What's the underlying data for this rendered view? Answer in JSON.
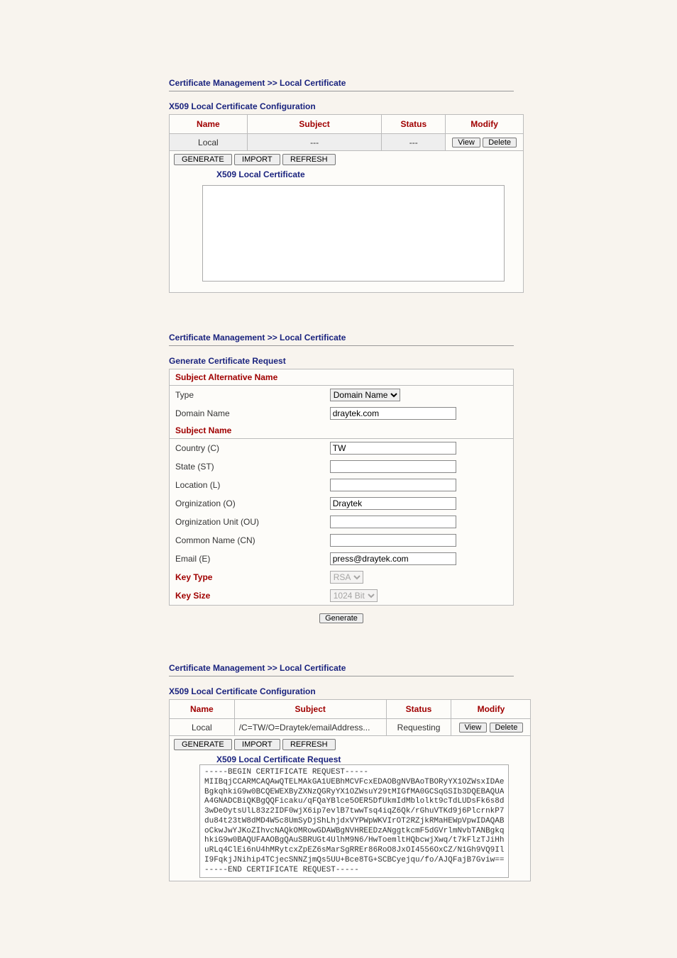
{
  "breadcrumb": "Certificate Management >> Local Certificate",
  "panel1": {
    "config_title": "X509 Local Certificate Configuration",
    "cols": {
      "name": "Name",
      "subject": "Subject",
      "status": "Status",
      "modify": "Modify"
    },
    "row": {
      "name": "Local",
      "subject": "---",
      "status": "---"
    },
    "btn_view": "View",
    "btn_delete": "Delete",
    "btn_generate": "GENERATE",
    "btn_import": "IMPORT",
    "btn_refresh": "REFRESH",
    "cert_title": "X509 Local Certificate",
    "cert_text": ""
  },
  "panel2": {
    "form_title": "Generate Certificate Request",
    "san_title": "Subject Alternative Name",
    "type_label": "Type",
    "type_value": "Domain Name",
    "dn_label": "Domain Name",
    "dn_value": "draytek.com",
    "sn_title": "Subject Name",
    "country_label": "Country (C)",
    "country_value": "TW",
    "state_label": "State (ST)",
    "state_value": "",
    "loc_label": "Location (L)",
    "loc_value": "",
    "org_label": "Orginization (O)",
    "org_value": "Draytek",
    "ou_label": "Orginization Unit (OU)",
    "ou_value": "",
    "cn_label": "Common Name (CN)",
    "cn_value": "",
    "email_label": "Email (E)",
    "email_value": "press@draytek.com",
    "keytype_label": "Key Type",
    "keytype_value": "RSA",
    "keysize_label": "Key Size",
    "keysize_value": "1024 Bit",
    "btn_generate": "Generate"
  },
  "panel3": {
    "config_title": "X509 Local Certificate Configuration",
    "cols": {
      "name": "Name",
      "subject": "Subject",
      "status": "Status",
      "modify": "Modify"
    },
    "row": {
      "name": "Local",
      "subject": "/C=TW/O=Draytek/emailAddress...",
      "status": "Requesting"
    },
    "btn_view": "View",
    "btn_delete": "Delete",
    "btn_generate": "GENERATE",
    "btn_import": "IMPORT",
    "btn_refresh": "REFRESH",
    "req_title": "X509 Local Certificate Request",
    "req_text": "-----BEGIN CERTIFICATE REQUEST-----\nMIIBqjCCARMCAQAwQTELMAkGA1UEBhMCVFcxEDAOBgNVBAoTBORyYX1OZWsxIDAe\nBgkqhkiG9w0BCQEWEXByZXNzQGRyYX1OZWsuY29tMIGfMA0GCSqGSIb3DQEBAQUA\nA4GNADCBiQKBgQQFicaku/qFQaYBlce5OER5DfUkmIdMblolkt9cTdLUDsFk6s8d\n3wDeOytsUlL83z2IDF0wjX6ip7evlB7twwTsq4iqZ6Qk/rGhuVTKd9j6PlcrnkP7\ndu84t23tW8dMD4W5c8UmSyDjShLhjdxVYPWpWKVIrOT2RZjkRMaHEWpVpwIDAQAB\noCkwJwYJKoZIhvcNAQkOMRowGDAWBgNVHREEDzANggtkcmF5dGVrlmNvbTANBgkq\nhkiG9w0BAQUFAAOBgQAuSBRUGt4UlhM9N6/HwToemltHQbcwjXwq/t7kFlzTJiHh\nuRLq4ClEi6nU4hMRytcxZpEZ6sMarSgRREr86RoO8JxOI4556OxCZ/N1Gh9VQ9Il\nI9FqkjJNihip4TCjecSNNZjmQs5UU+Bce8TG+SCBCyejqu/fo/AJQFajB7Gviw==\n-----END CERTIFICATE REQUEST-----"
  }
}
